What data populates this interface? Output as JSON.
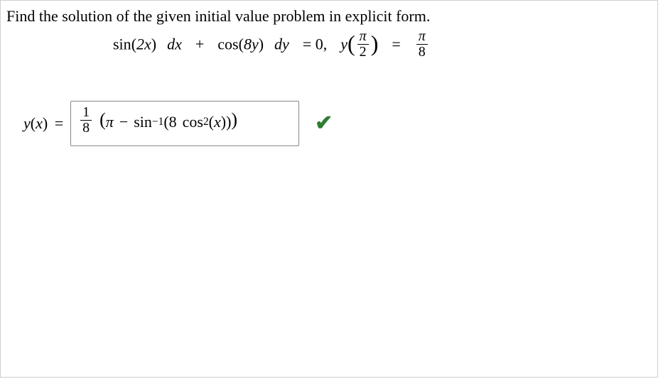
{
  "problem": {
    "prompt_text": "Find the solution of the given initial value problem in explicit form.",
    "equation": {
      "lhs_term1_func": "sin",
      "lhs_term1_arg": "2x",
      "lhs_term1_dx": "dx",
      "plus": "+",
      "lhs_term2_func": "cos",
      "lhs_term2_arg": "8y",
      "lhs_term2_dy": "dy",
      "equals_zero": "= 0,",
      "initial_y": "y",
      "initial_x_num": "π",
      "initial_x_den": "2",
      "equals": "=",
      "rhs_num": "π",
      "rhs_den": "8"
    }
  },
  "answer": {
    "lhs_y": "y",
    "lhs_x": "x",
    "equals": "=",
    "frac_num": "1",
    "frac_den": "8",
    "open_paren": "(",
    "pi": "π",
    "minus": "−",
    "sin": "sin",
    "sin_exp": "−1",
    "inner_open": "(",
    "eight": "8",
    "space": " ",
    "cos": "cos",
    "cos_exp": "2",
    "inner_x_open": "(",
    "inner_x": "x",
    "inner_x_close": ")",
    "inner_close": ")",
    "close_paren": ")"
  },
  "status": {
    "correct_mark": "✔",
    "correct_color": "#2e7d32"
  }
}
